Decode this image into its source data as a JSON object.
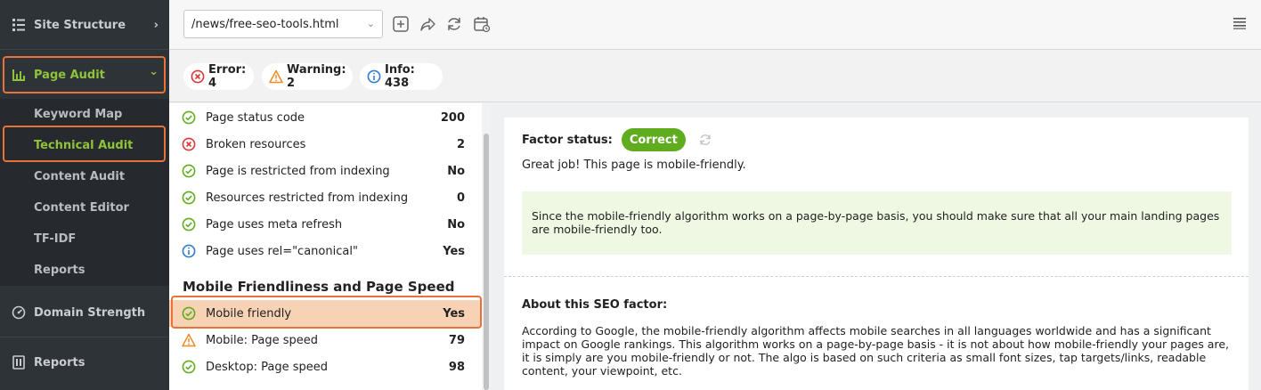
{
  "sidebar": {
    "site_structure": "Site Structure",
    "page_audit": "Page Audit",
    "sub_items": [
      "Keyword Map",
      "Technical Audit",
      "Content Audit",
      "Content Editor",
      "TF-IDF",
      "Reports"
    ],
    "domain_strength": "Domain Strength",
    "reports": "Reports",
    "chevron_right": "›",
    "chevron_down": "⌄"
  },
  "toolbar": {
    "url_value": "/news/free-seo-tools.html",
    "caret": "⌄"
  },
  "filters": {
    "error": "Error: 4",
    "warning": "Warning: 2",
    "info": "Info: 438"
  },
  "factors": {
    "rows": [
      {
        "label": "Page status code",
        "value": "200",
        "status": "ok"
      },
      {
        "label": "Broken resources",
        "value": "2",
        "status": "error"
      },
      {
        "label": "Page is restricted from indexing",
        "value": "No",
        "status": "ok"
      },
      {
        "label": "Resources restricted from indexing",
        "value": "0",
        "status": "ok"
      },
      {
        "label": "Page uses meta refresh",
        "value": "No",
        "status": "ok"
      },
      {
        "label": "Page uses rel=\"canonical\"",
        "value": "Yes",
        "status": "info"
      }
    ],
    "section_title": "Mobile Friendliness and Page Speed",
    "mobile_rows": [
      {
        "label": "Mobile friendly",
        "value": "Yes",
        "status": "ok"
      },
      {
        "label": "Mobile: Page speed",
        "value": "79",
        "status": "warning"
      },
      {
        "label": "Desktop: Page speed",
        "value": "98",
        "status": "ok"
      }
    ]
  },
  "detail": {
    "factor_status_label": "Factor status:",
    "status_badge": "Correct",
    "summary": "Great job! This page is mobile-friendly.",
    "tip": "Since the mobile-friendly algorithm works on a page-by-page basis, you should make sure that all your main landing pages are mobile-friendly too.",
    "about_title": "About this SEO factor:",
    "about_text": "According to Google, the mobile-friendly algorithm affects mobile searches in all languages worldwide and has a significant impact on Google rankings. This algorithm works on a page-by-page basis - it is not about how mobile-friendly your pages are, it is simply are you mobile-friendly or not. The algo is based on such criteria as small font sizes, tap targets/links, readable content, your viewpoint, etc."
  },
  "colors": {
    "ok": "#5fac1e",
    "error": "#d9383a",
    "warning": "#f08a24",
    "info": "#2f7fd0",
    "accent": "#e8733a"
  }
}
